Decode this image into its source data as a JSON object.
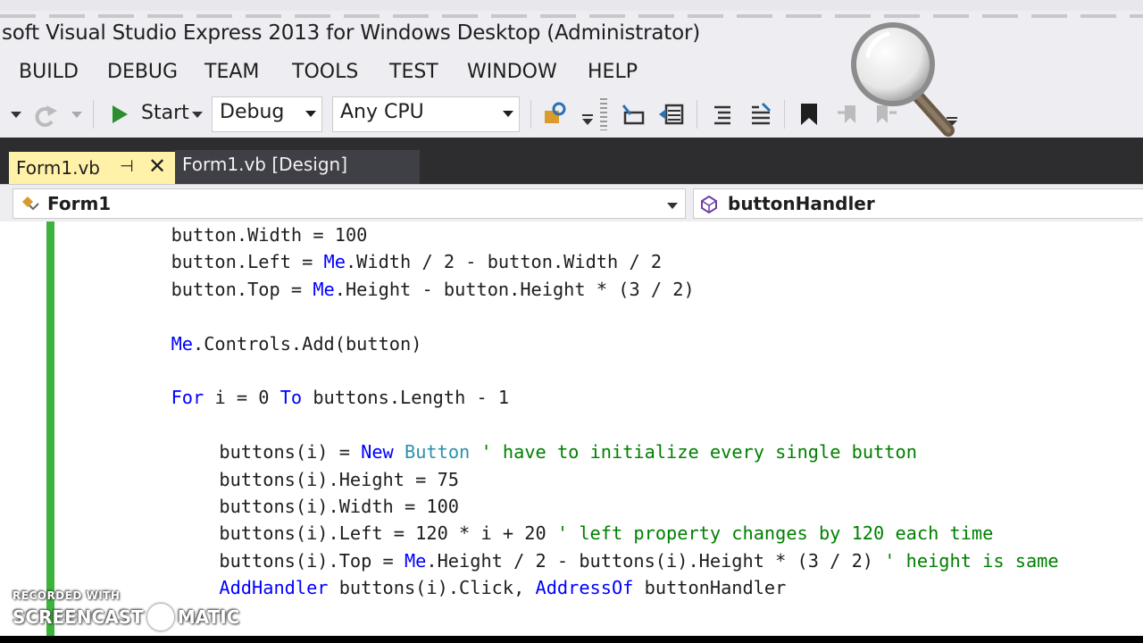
{
  "window": {
    "title": "soft Visual Studio Express 2013 for Windows Desktop (Administrator)"
  },
  "menu": {
    "items": [
      "BUILD",
      "DEBUG",
      "TEAM",
      "TOOLS",
      "TEST",
      "WINDOW",
      "HELP"
    ]
  },
  "toolbar": {
    "start_label": "Start",
    "config_value": "Debug",
    "platform_value": "Any CPU"
  },
  "tabs": [
    {
      "label": "Form1.vb",
      "pin": "⊣",
      "close": "✕",
      "active": true
    },
    {
      "label": "Form1.vb [Design]",
      "active": false
    }
  ],
  "navbar": {
    "class_value": "Form1",
    "member_value": "buttonHandler"
  },
  "code_lines": [
    {
      "indent": "        ",
      "parts": [
        [
          "",
          "button.Width = 100"
        ]
      ]
    },
    {
      "indent": "        ",
      "parts": [
        [
          "",
          "button.Left = "
        ],
        [
          "kw",
          "Me"
        ],
        [
          "",
          ".Width / 2 - button.Width / 2"
        ]
      ]
    },
    {
      "indent": "        ",
      "parts": [
        [
          "",
          "button.Top = "
        ],
        [
          "kw",
          "Me"
        ],
        [
          "",
          ".Height - button.Height * (3 / 2)"
        ]
      ]
    },
    {
      "indent": "",
      "parts": []
    },
    {
      "indent": "        ",
      "parts": [
        [
          "kw",
          "Me"
        ],
        [
          "",
          ".Controls.Add(button)"
        ]
      ]
    },
    {
      "indent": "",
      "parts": []
    },
    {
      "indent": "        ",
      "parts": [
        [
          "kw",
          "For"
        ],
        [
          "",
          " i = 0 "
        ],
        [
          "kw",
          "To"
        ],
        [
          "",
          " buttons.Length - 1"
        ]
      ]
    },
    {
      "indent": "",
      "parts": []
    },
    {
      "indent": "            ",
      "parts": [
        [
          "",
          "buttons(i) = "
        ],
        [
          "kw",
          "New"
        ],
        [
          "",
          " "
        ],
        [
          "ty",
          "Button"
        ],
        [
          "",
          " "
        ],
        [
          "cm",
          "' have to initialize every single button"
        ]
      ]
    },
    {
      "indent": "            ",
      "parts": [
        [
          "",
          "buttons(i).Height = 75"
        ]
      ]
    },
    {
      "indent": "            ",
      "parts": [
        [
          "",
          "buttons(i).Width = 100"
        ]
      ]
    },
    {
      "indent": "            ",
      "parts": [
        [
          "",
          "buttons(i).Left = 120 * i + 20 "
        ],
        [
          "cm",
          "' left property changes by 120 each time"
        ]
      ]
    },
    {
      "indent": "            ",
      "parts": [
        [
          "",
          "buttons(i).Top = "
        ],
        [
          "kw",
          "Me"
        ],
        [
          "",
          ".Height / 2 - buttons(i).Height * (3 / 2) "
        ],
        [
          "cm",
          "' height is same"
        ]
      ]
    },
    {
      "indent": "            ",
      "parts": [
        [
          "kw",
          "AddHandler"
        ],
        [
          "",
          " buttons(i).Click, "
        ],
        [
          "kw",
          "AddressOf"
        ],
        [
          "",
          " buttonHandler"
        ]
      ]
    }
  ],
  "watermark": {
    "line1": "RECORDED WITH",
    "line2a": "SCREENCAST",
    "line2b": "MATIC"
  },
  "colors": {
    "keyword": "#0000ff",
    "comment": "#008000",
    "type": "#2b91af",
    "active_tab": "#fff1a8",
    "change_bar": "#3cb43c"
  }
}
